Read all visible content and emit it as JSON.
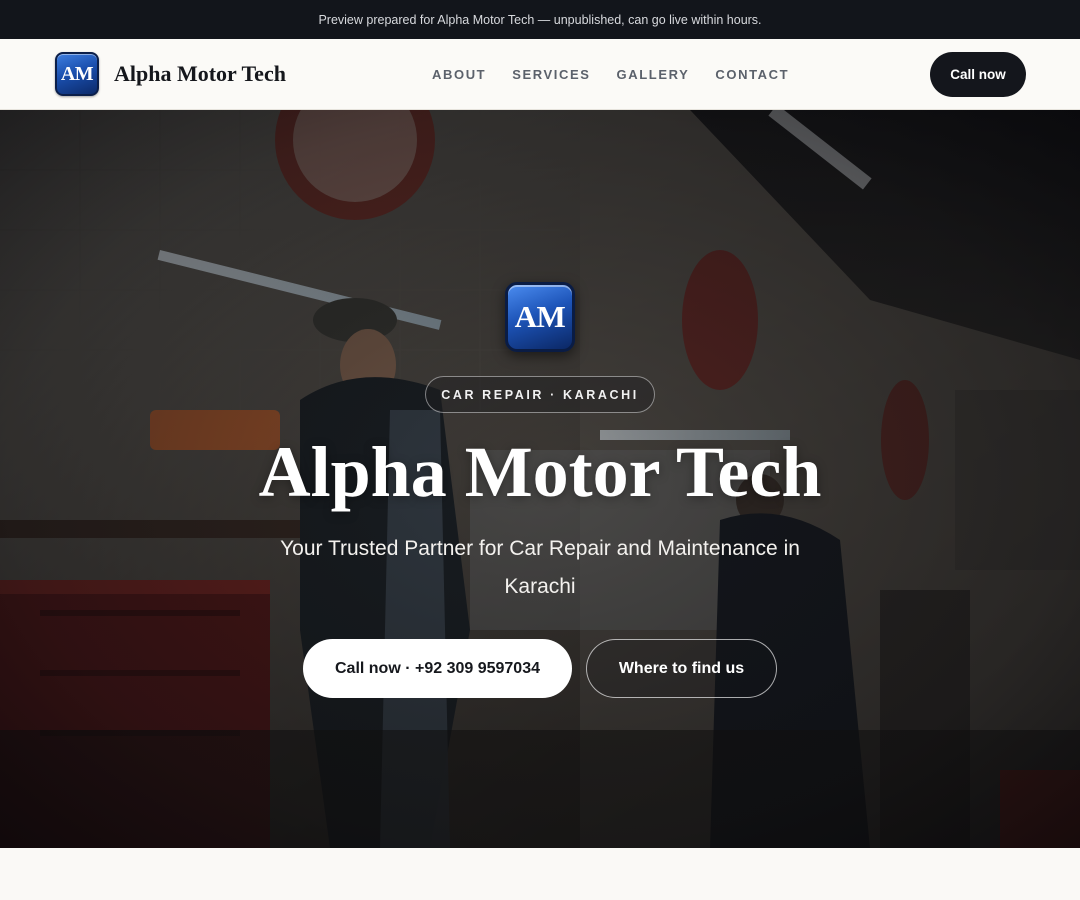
{
  "banner": {
    "text": "Preview prepared for Alpha Motor Tech — unpublished, can go live within hours."
  },
  "header": {
    "logo_text": "AM",
    "brand_name": "Alpha Motor Tech",
    "nav": [
      {
        "label": "ABOUT"
      },
      {
        "label": "SERVICES"
      },
      {
        "label": "GALLERY"
      },
      {
        "label": "CONTACT"
      }
    ],
    "cta_label": "Call now"
  },
  "hero": {
    "logo_text": "AM",
    "tag": "CAR REPAIR · KARACHI",
    "title": "Alpha Motor Tech",
    "subtitle": "Your Trusted Partner for Car Repair and Maintenance in Karachi",
    "primary_button": "Call now · +92 309 9597034",
    "secondary_button": "Where to find us",
    "background_image": "garage-workshop-photo"
  },
  "colors": {
    "banner_bg": "#12151b",
    "header_bg": "#fbfaf7",
    "cta_bg": "#14161c",
    "logo_blue": "#1d54b8",
    "page_bg": "#faf9f6"
  }
}
